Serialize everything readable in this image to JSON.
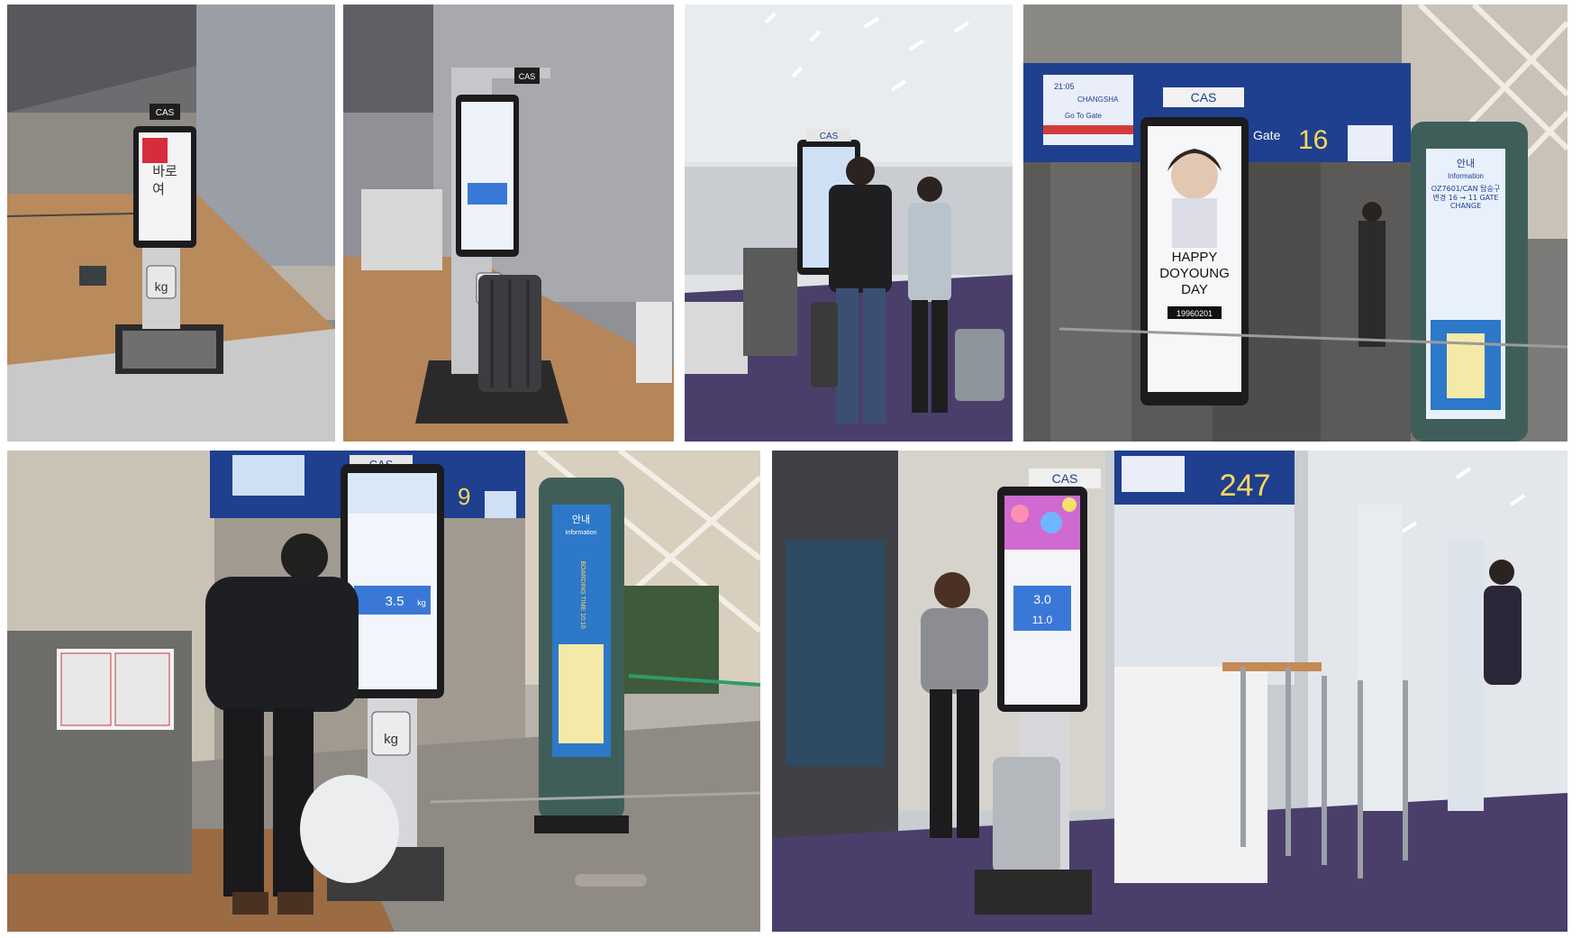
{
  "photos": [
    {
      "id": "p1",
      "texts": {
        "brand": "CAS",
        "screen_line1": "바로",
        "screen_line2": "여",
        "scale_label": "kg"
      }
    },
    {
      "id": "p2",
      "texts": {
        "brand": "CAS",
        "scale_label": "kg"
      }
    },
    {
      "id": "p3",
      "texts": {
        "brand": "CAS"
      }
    },
    {
      "id": "p4",
      "texts": {
        "brand": "CAS",
        "flight_time": "21:05",
        "flight_dest": "CHANGSHA",
        "flight_status": "Go To Gate",
        "gate_word": "Gate",
        "gate_number": "16",
        "ad_line1": "HAPPY",
        "ad_line2": "DOYOUNG",
        "ad_line3": "DAY",
        "ad_date": "19960201",
        "info_title": "안내",
        "info_sub": "Information",
        "info_notice": "OZ7601/CAN 탑승구변경 16 → 11 GATE CHANGE"
      }
    },
    {
      "id": "p5",
      "texts": {
        "brand": "CAS",
        "gate_number": "9",
        "weight_reading": "3.5",
        "weight_unit": "kg",
        "scale_label": "kg",
        "info_title": "안내",
        "info_sub": "Information",
        "info_boarding": "BOARDING TIME 10:10"
      }
    },
    {
      "id": "p6",
      "texts": {
        "brand": "CAS",
        "gate_number": "247",
        "weight_reading": "3.0",
        "weight_sub": "11.0"
      }
    }
  ],
  "colors": {
    "cas_blue": "#1f3f8f",
    "screen_blue": "#3a78d8",
    "floor_wood": "#a97a4e",
    "carpet_purple": "#4a3f6b"
  }
}
